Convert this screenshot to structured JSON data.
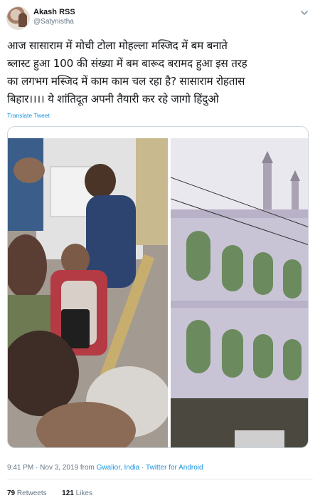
{
  "user": {
    "display_name": "Akash RSS",
    "handle": "@Satynistha"
  },
  "tweet": {
    "lines": [
      "आज सासाराम में  मोची टोला मोहल्ला मस्जिद में बम बनाते",
      "ब्लास्ट हुआ 100 की संख्या में बम बारूद बरामद हुआ इस तरह",
      "का लगभग मस्जिद में काम  काम चल रहा है? सासाराम रोहतास",
      "बिहार।।।। ये शांतिदूत अपनी तैयारी कर रहे जागो हिंदुओ"
    ],
    "translate_label": "Translate Tweet"
  },
  "meta": {
    "time": "9:41 PM",
    "date": "Nov 3, 2019",
    "from_word": "from",
    "location": "Gwalior, India",
    "separator": "·",
    "client": "Twitter for Android"
  },
  "stats": {
    "retweets_count": "79",
    "retweets_label": "Retweets",
    "likes_count": "121",
    "likes_label": "Likes"
  },
  "colors": {
    "link": "#1b95e0",
    "secondary_text": "#657786",
    "primary_text": "#14171a"
  },
  "icons": {
    "caret": "chevron-down-icon",
    "avatar": "avatar"
  }
}
